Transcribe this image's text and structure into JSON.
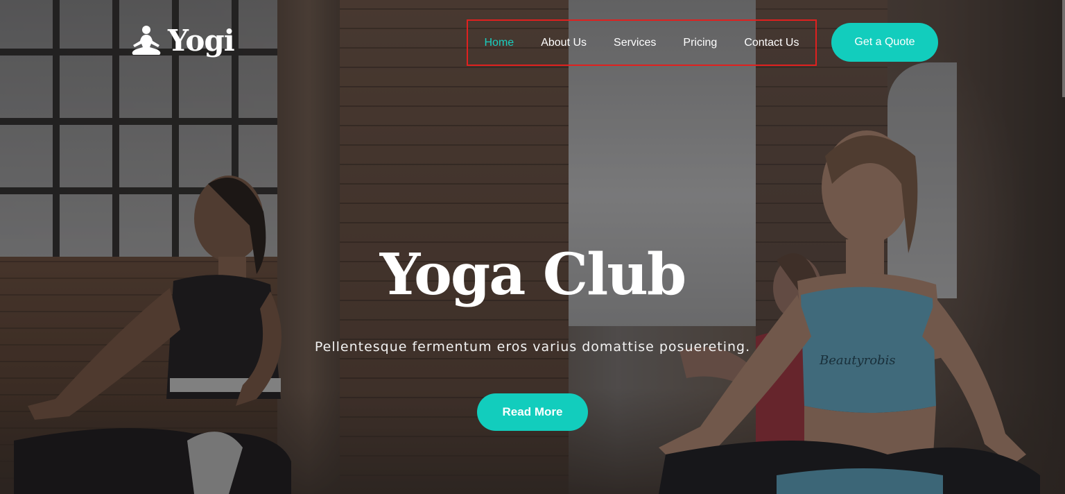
{
  "brand": {
    "name": "Yogi",
    "icon": "meditation-figure-icon"
  },
  "nav": {
    "items": [
      {
        "label": "Home",
        "active": true
      },
      {
        "label": "About Us",
        "active": false
      },
      {
        "label": "Services",
        "active": false
      },
      {
        "label": "Pricing",
        "active": false
      },
      {
        "label": "Contact Us",
        "active": false
      }
    ]
  },
  "header": {
    "cta_label": "Get a Quote"
  },
  "hero": {
    "title": "Yoga Club",
    "subtitle": "Pellentesque fermentum eros varius domattise posuereting.",
    "button_label": "Read More",
    "top_print": "Beautyrobis"
  },
  "colors": {
    "accent": "#12cdbd",
    "active_nav": "#19cfc0",
    "highlight_border": "#e0201f",
    "text": "#ffffff"
  }
}
